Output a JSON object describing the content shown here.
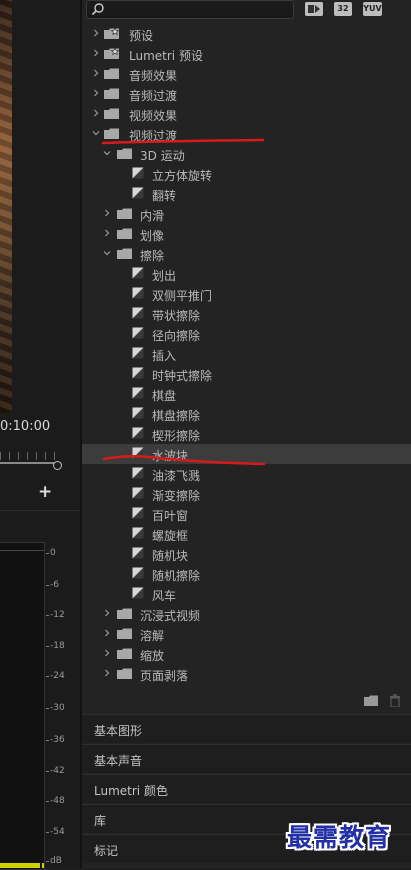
{
  "monitor": {
    "timecode": "0:10:00",
    "add_symbol": "+",
    "meter_scale": [
      "0",
      "-6",
      "-12",
      "-18",
      "-24",
      "-30",
      "-36",
      "-42",
      "-48",
      "-54",
      "dB"
    ]
  },
  "toolbar": {
    "buttons": [
      "32",
      "YUV"
    ]
  },
  "effects_tree": [
    {
      "label": "预设",
      "level": 0,
      "kind": "folder-star",
      "open": false
    },
    {
      "label": "Lumetri 预设",
      "level": 0,
      "kind": "folder-star",
      "open": false
    },
    {
      "label": "音频效果",
      "level": 0,
      "kind": "folder",
      "open": false
    },
    {
      "label": "音频过渡",
      "level": 0,
      "kind": "folder",
      "open": false
    },
    {
      "label": "视频效果",
      "level": 0,
      "kind": "folder",
      "open": false
    },
    {
      "label": "视频过渡",
      "level": 0,
      "kind": "folder",
      "open": true
    },
    {
      "label": "3D 运动",
      "level": 1,
      "kind": "folder",
      "open": true
    },
    {
      "label": "立方体旋转",
      "level": 2,
      "kind": "fx"
    },
    {
      "label": "翻转",
      "level": 2,
      "kind": "fx"
    },
    {
      "label": "内滑",
      "level": 1,
      "kind": "folder",
      "open": false
    },
    {
      "label": "划像",
      "level": 1,
      "kind": "folder",
      "open": false
    },
    {
      "label": "擦除",
      "level": 1,
      "kind": "folder",
      "open": true
    },
    {
      "label": "划出",
      "level": 2,
      "kind": "fx"
    },
    {
      "label": "双侧平推门",
      "level": 2,
      "kind": "fx"
    },
    {
      "label": "带状擦除",
      "level": 2,
      "kind": "fx"
    },
    {
      "label": "径向擦除",
      "level": 2,
      "kind": "fx"
    },
    {
      "label": "插入",
      "level": 2,
      "kind": "fx"
    },
    {
      "label": "时钟式擦除",
      "level": 2,
      "kind": "fx"
    },
    {
      "label": "棋盘",
      "level": 2,
      "kind": "fx"
    },
    {
      "label": "棋盘擦除",
      "level": 2,
      "kind": "fx"
    },
    {
      "label": "楔形擦除",
      "level": 2,
      "kind": "fx"
    },
    {
      "label": "水波块",
      "level": 2,
      "kind": "fx",
      "selected": true
    },
    {
      "label": "油漆飞溅",
      "level": 2,
      "kind": "fx"
    },
    {
      "label": "渐变擦除",
      "level": 2,
      "kind": "fx"
    },
    {
      "label": "百叶窗",
      "level": 2,
      "kind": "fx"
    },
    {
      "label": "螺旋框",
      "level": 2,
      "kind": "fx"
    },
    {
      "label": "随机块",
      "level": 2,
      "kind": "fx"
    },
    {
      "label": "随机擦除",
      "level": 2,
      "kind": "fx"
    },
    {
      "label": "风车",
      "level": 2,
      "kind": "fx"
    },
    {
      "label": "沉浸式视频",
      "level": 1,
      "kind": "folder",
      "open": false
    },
    {
      "label": "溶解",
      "level": 1,
      "kind": "folder",
      "open": false
    },
    {
      "label": "缩放",
      "level": 1,
      "kind": "folder",
      "open": false
    },
    {
      "label": "页面剥落",
      "level": 1,
      "kind": "folder",
      "open": false
    }
  ],
  "panels": [
    "基本图形",
    "基本声音",
    "Lumetri 颜色",
    "库",
    "标记"
  ],
  "watermark": "最需教育",
  "colors": {
    "annotation_red": "#d91a1a",
    "watermark_blue": "#2230a8",
    "meter_yellow": "#d0d000"
  }
}
